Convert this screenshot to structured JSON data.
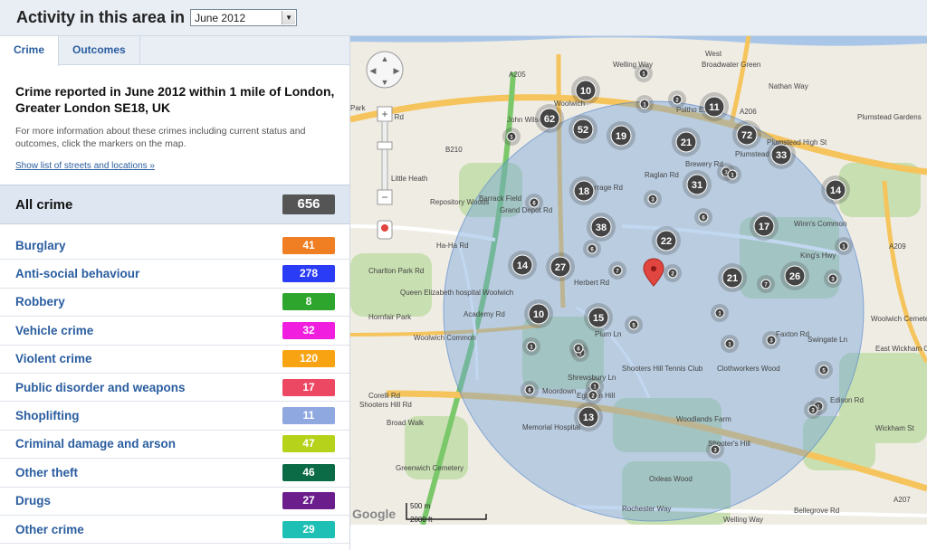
{
  "header": {
    "title": "Activity in this area in",
    "period_selected": "June 2012"
  },
  "tabs": [
    {
      "label": "Crime",
      "active": true
    },
    {
      "label": "Outcomes",
      "active": false
    }
  ],
  "info": {
    "heading": "Crime reported in June 2012 within 1 mile of London, Greater London SE18, UK",
    "description": "For more information about these crimes including current status and outcomes, click the markers on the map.",
    "link": "Show list of streets and locations »"
  },
  "all_crime": {
    "label": "All crime",
    "count": "656"
  },
  "categories": [
    {
      "name": "Burglary",
      "count": "41",
      "color": "#f07e22"
    },
    {
      "name": "Anti-social behaviour",
      "count": "278",
      "color": "#2a3cf5"
    },
    {
      "name": "Robbery",
      "count": "8",
      "color": "#2ea52c"
    },
    {
      "name": "Vehicle crime",
      "count": "32",
      "color": "#f01fe0"
    },
    {
      "name": "Violent crime",
      "count": "120",
      "color": "#f8a412"
    },
    {
      "name": "Public disorder and weapons",
      "count": "17",
      "color": "#ec4863"
    },
    {
      "name": "Shoplifting",
      "count": "11",
      "color": "#8fa8e0"
    },
    {
      "name": "Criminal damage and arson",
      "count": "47",
      "color": "#b6d21a"
    },
    {
      "name": "Other theft",
      "count": "46",
      "color": "#0c6b47"
    },
    {
      "name": "Drugs",
      "count": "27",
      "color": "#6b1d8c"
    },
    {
      "name": "Other crime",
      "count": "29",
      "color": "#1ec0b5"
    }
  ],
  "map": {
    "place_labels": [
      "West",
      "Broadwater Green",
      "Welling Way",
      "Nathan Way",
      "Woolwich",
      "Plumstead Gardens",
      "Poltho Estate",
      "Plumstead High St",
      "Plumstead",
      "Raglan Rd",
      "Brewery Rd",
      "Barrack Field",
      "Repository Woods",
      "Winn's Common",
      "King's Hwy",
      "Ha-Ha Rd",
      "Charlton Park Rd",
      "Queen Elizabeth hospital Woolwich",
      "Hornfair Park",
      "Woolwich Common",
      "Shooters Hill Tennis Club",
      "Clothworkers Wood",
      "Woodlands Farm",
      "Shooter's Hill",
      "Memorial Hospital",
      "Greenwich Cemetery",
      "Oxleas Wood",
      "Woolwich Cemetery",
      "East Wickham Open Space",
      "Shooters Hill Rd",
      "Bellegrove Rd",
      "Rochester Way",
      "Welling Way",
      "Broad Walk",
      "Wickham St",
      "Academy Rd",
      "Plum Ln",
      "Edison Rd",
      "Faxton Rd",
      "Burrage Rd",
      "Herbert Rd",
      "Grand Depot Rd",
      "John Wilson St",
      "Little Heath",
      "B210",
      "A206",
      "A205",
      "A207",
      "A209",
      "Swingate Ln",
      "Shrewsbury Ln",
      "Moordown",
      "Eglinton Hill",
      "Corelli Rd",
      "Park Rd",
      "Park"
    ],
    "clusters": [
      "10",
      "62",
      "52",
      "19",
      "11",
      "72",
      "21",
      "33",
      "18",
      "31",
      "14",
      "38",
      "22",
      "17",
      "14",
      "27",
      "21",
      "26",
      "10",
      "15",
      "13",
      "1",
      "2",
      "1",
      "1",
      "3",
      "1",
      "6",
      "3",
      "6",
      "6",
      "1",
      "7",
      "2",
      "7",
      "3",
      "1",
      "1",
      "1",
      "5",
      "3",
      "6",
      "6",
      "1",
      "5",
      "1",
      "1",
      "3",
      "3",
      "2"
    ],
    "scale": {
      "metric": "500 m",
      "imperial": "2000 ft"
    },
    "logo": "Google"
  }
}
